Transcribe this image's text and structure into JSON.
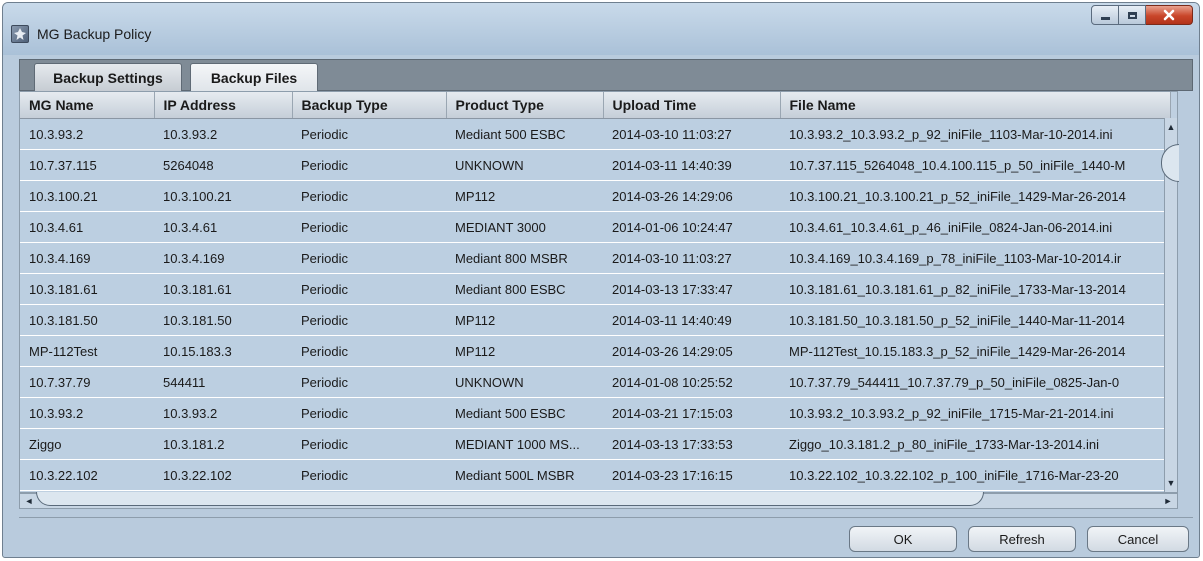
{
  "window": {
    "title": "MG Backup Policy"
  },
  "tabs": [
    {
      "label": "Backup Settings",
      "active": false
    },
    {
      "label": "Backup Files",
      "active": true
    }
  ],
  "table": {
    "columns": [
      "MG Name",
      "IP Address",
      "Backup Type",
      "Product Type",
      "Upload Time",
      "File Name"
    ],
    "rows": [
      [
        "10.3.93.2",
        "10.3.93.2",
        "Periodic",
        "Mediant 500 ESBC",
        "2014-03-10 11:03:27",
        "10.3.93.2_10.3.93.2_p_92_iniFile_1103-Mar-10-2014.ini"
      ],
      [
        "10.7.37.115",
        "5264048",
        "Periodic",
        "UNKNOWN",
        "2014-03-11 14:40:39",
        "10.7.37.115_5264048_10.4.100.115_p_50_iniFile_1440-M"
      ],
      [
        "10.3.100.21",
        "10.3.100.21",
        "Periodic",
        "MP112",
        "2014-03-26 14:29:06",
        "10.3.100.21_10.3.100.21_p_52_iniFile_1429-Mar-26-2014"
      ],
      [
        "10.3.4.61",
        "10.3.4.61",
        "Periodic",
        "MEDIANT 3000",
        "2014-01-06 10:24:47",
        "10.3.4.61_10.3.4.61_p_46_iniFile_0824-Jan-06-2014.ini"
      ],
      [
        "10.3.4.169",
        "10.3.4.169",
        "Periodic",
        "Mediant 800 MSBR",
        "2014-03-10 11:03:27",
        "10.3.4.169_10.3.4.169_p_78_iniFile_1103-Mar-10-2014.ir"
      ],
      [
        "10.3.181.61",
        "10.3.181.61",
        "Periodic",
        "Mediant 800 ESBC",
        "2014-03-13 17:33:47",
        "10.3.181.61_10.3.181.61_p_82_iniFile_1733-Mar-13-2014"
      ],
      [
        "10.3.181.50",
        "10.3.181.50",
        "Periodic",
        "MP112",
        "2014-03-11 14:40:49",
        "10.3.181.50_10.3.181.50_p_52_iniFile_1440-Mar-11-2014"
      ],
      [
        "MP-112Test",
        "10.15.183.3",
        "Periodic",
        "MP112",
        "2014-03-26 14:29:05",
        "MP-112Test_10.15.183.3_p_52_iniFile_1429-Mar-26-2014"
      ],
      [
        "10.7.37.79",
        "544411",
        "Periodic",
        "UNKNOWN",
        "2014-01-08 10:25:52",
        "10.7.37.79_544411_10.7.37.79_p_50_iniFile_0825-Jan-0"
      ],
      [
        "10.3.93.2",
        "10.3.93.2",
        "Periodic",
        "Mediant 500 ESBC",
        "2014-03-21 17:15:03",
        "10.3.93.2_10.3.93.2_p_92_iniFile_1715-Mar-21-2014.ini"
      ],
      [
        "Ziggo",
        "10.3.181.2",
        "Periodic",
        "MEDIANT 1000 MS...",
        "2014-03-13 17:33:53",
        "Ziggo_10.3.181.2_p_80_iniFile_1733-Mar-13-2014.ini"
      ],
      [
        "10.3.22.102",
        "10.3.22.102",
        "Periodic",
        "Mediant 500L MSBR",
        "2014-03-23 17:16:15",
        "10.3.22.102_10.3.22.102_p_100_iniFile_1716-Mar-23-20"
      ]
    ]
  },
  "buttons": {
    "ok": "OK",
    "refresh": "Refresh",
    "cancel": "Cancel"
  },
  "icons": {
    "app": "app-icon",
    "minimize": "minimize-icon",
    "maximize": "maximize-icon",
    "close": "close-icon",
    "scroll_up": "arrow-up-icon",
    "scroll_down": "arrow-down-icon",
    "scroll_left": "arrow-left-icon",
    "scroll_right": "arrow-right-icon"
  },
  "colors": {
    "close_button": "#c9462a",
    "row_background": "#bccfe1",
    "tab_strip": "#7f8b96"
  }
}
